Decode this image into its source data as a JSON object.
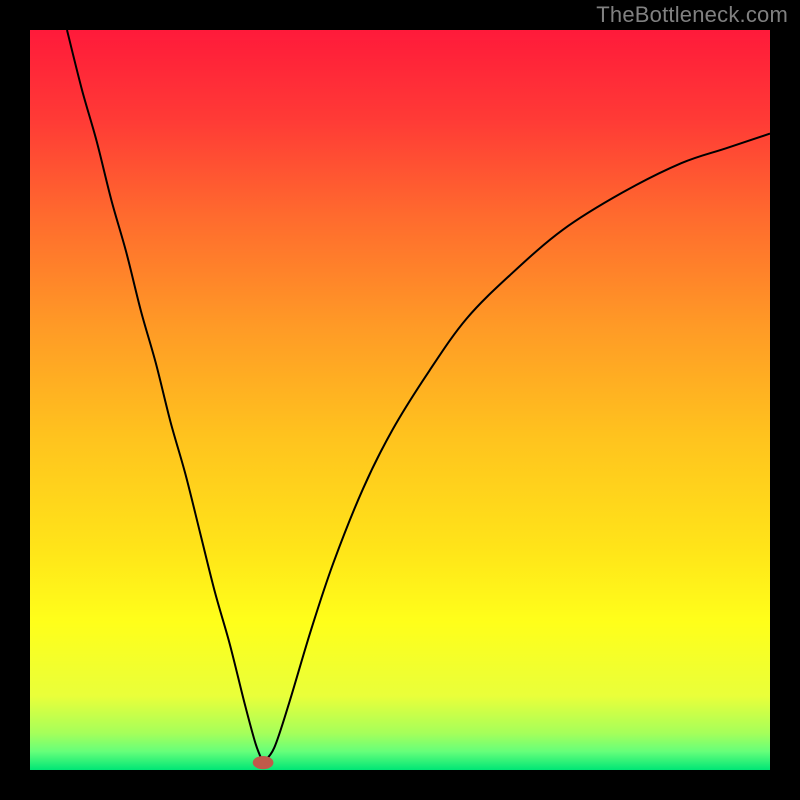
{
  "watermark": "TheBottleneck.com",
  "chart_data": {
    "type": "line",
    "title": "",
    "xlabel": "",
    "ylabel": "",
    "xlim": [
      0,
      100
    ],
    "ylim": [
      0,
      100
    ],
    "grid": false,
    "legend": false,
    "plot_background": {
      "gradient_stops": [
        {
          "offset": 0.0,
          "color": "#ff1a3a"
        },
        {
          "offset": 0.12,
          "color": "#ff3a36"
        },
        {
          "offset": 0.25,
          "color": "#ff6a2e"
        },
        {
          "offset": 0.4,
          "color": "#ff9a26"
        },
        {
          "offset": 0.55,
          "color": "#ffc31e"
        },
        {
          "offset": 0.7,
          "color": "#ffe419"
        },
        {
          "offset": 0.8,
          "color": "#ffff1a"
        },
        {
          "offset": 0.9,
          "color": "#e9ff3a"
        },
        {
          "offset": 0.95,
          "color": "#a6ff5a"
        },
        {
          "offset": 0.975,
          "color": "#66ff7a"
        },
        {
          "offset": 1.0,
          "color": "#00e676"
        }
      ]
    },
    "series": [
      {
        "name": "left-branch",
        "color": "#000000",
        "x": [
          5,
          7,
          9,
          11,
          13,
          15,
          17,
          19,
          21,
          23,
          25,
          27,
          29,
          30.5,
          31.5
        ],
        "y": [
          100,
          92,
          85,
          77,
          70,
          62,
          55,
          47,
          40,
          32,
          24,
          17,
          9,
          3.5,
          1
        ]
      },
      {
        "name": "right-branch",
        "color": "#000000",
        "x": [
          31.5,
          33,
          35,
          38,
          41,
          45,
          49,
          54,
          59,
          65,
          72,
          80,
          88,
          94,
          100
        ],
        "y": [
          1,
          3,
          9,
          19,
          28,
          38,
          46,
          54,
          61,
          67,
          73,
          78,
          82,
          84,
          86
        ]
      }
    ],
    "marker": {
      "name": "bottleneck-point",
      "x": 31.5,
      "y": 1,
      "rx": 1.4,
      "ry": 0.9,
      "color": "#c05a4a"
    }
  }
}
